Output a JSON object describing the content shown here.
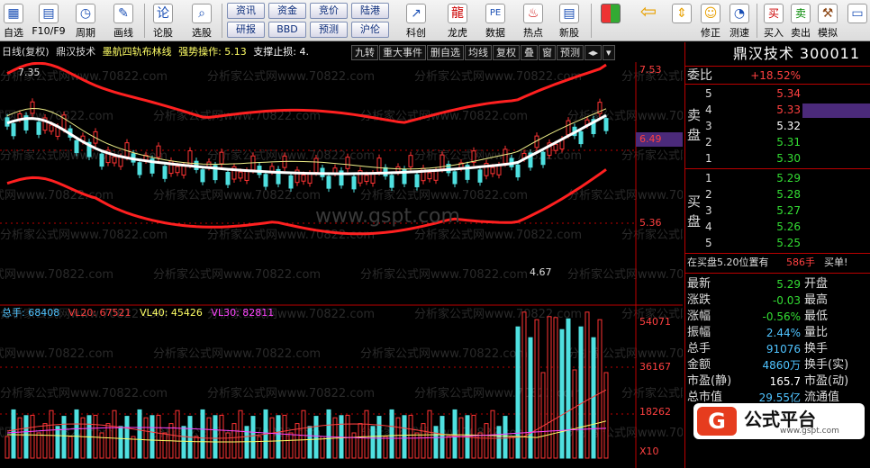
{
  "toolbar": {
    "buttons": [
      {
        "label": "自选",
        "icon": "star-grid-icon"
      },
      {
        "label": "F10/F9",
        "icon": "f10-icon"
      },
      {
        "label": "周期",
        "icon": "clock-icon"
      },
      {
        "label": "画线",
        "icon": "pencil-icon"
      },
      {
        "label": "论股",
        "icon": "forum-icon"
      },
      {
        "label": "选股",
        "icon": "search-icon"
      },
      {
        "label": "科创",
        "icon": "chart-icon"
      },
      {
        "label": "龙虎",
        "icon": "dragon-icon"
      },
      {
        "label": "数据",
        "icon": "pe-icon"
      },
      {
        "label": "热点",
        "icon": "hot-icon"
      },
      {
        "label": "新股",
        "icon": "new-stock-icon"
      },
      {
        "label": "修正",
        "icon": "smile-icon"
      },
      {
        "label": "测速",
        "icon": "speed-icon"
      },
      {
        "label": "买入",
        "icon": "buy-icon"
      },
      {
        "label": "卖出",
        "icon": "sell-icon"
      },
      {
        "label": "模拟",
        "icon": "hammer-icon"
      }
    ],
    "small_buttons": [
      "资讯",
      "资金",
      "竞价",
      "陆港",
      "研报",
      "BBD",
      "预测",
      "沪伦"
    ]
  },
  "infobar": {
    "period": "日线(复权)",
    "stock_name": "鼎汉技术",
    "indicator": "墨航四轨布林线",
    "trend_label": "强势操作: 5.13",
    "stop_label": "支撑止损: 4."
  },
  "indicator_tabs": [
    "九转",
    "重大事件",
    "删自选",
    "均线",
    "复权",
    "叠",
    "窗",
    "预测"
  ],
  "price_axis": {
    "top": "7.53",
    "mid": "6.49",
    "low": "5.36"
  },
  "price_marks": {
    "high": "7.35",
    "low": "4.67"
  },
  "volume_legend": {
    "total_label": "总手: 68408",
    "vl20": "VL20: 67521",
    "vl40": "VL40: 45426",
    "vl30": "VL30: 82811"
  },
  "volume_axis": {
    "top": "54071",
    "mid": "36167",
    "low": "18262",
    "unit": "X10"
  },
  "watermark": "分析家公式网www.70822.com",
  "center_watermark": "www.gspt.com",
  "panel": {
    "title": "鼎汉技术 300011",
    "weibi_label": "委比",
    "weibi_value": "+18.52%",
    "sell_label": "卖盘",
    "buy_label": "买盘",
    "sells": [
      {
        "level": "5",
        "price": "5.34"
      },
      {
        "level": "4",
        "price": "5.33"
      },
      {
        "level": "3",
        "price": "5.32"
      },
      {
        "level": "2",
        "price": "5.31"
      },
      {
        "level": "1",
        "price": "5.30"
      }
    ],
    "buys": [
      {
        "level": "1",
        "price": "5.29"
      },
      {
        "level": "2",
        "price": "5.28"
      },
      {
        "level": "3",
        "price": "5.27"
      },
      {
        "level": "4",
        "price": "5.26"
      },
      {
        "level": "5",
        "price": "5.25"
      }
    ],
    "notice": "在买盘5.20位置有",
    "notice_qty": "586手",
    "notice_tail": "买单!",
    "stats": [
      {
        "k": "最新",
        "v": "5.29",
        "k2": "开盘",
        "color": "#33dd33"
      },
      {
        "k": "涨跌",
        "v": "-0.03",
        "k2": "最高",
        "color": "#33dd33"
      },
      {
        "k": "涨幅",
        "v": "-0.56%",
        "k2": "最低",
        "color": "#33dd33"
      },
      {
        "k": "振幅",
        "v": "2.44%",
        "k2": "量比",
        "color": "#4fc3ff"
      },
      {
        "k": "总手",
        "v": "91076",
        "k2": "换手",
        "color": "#4fc3ff"
      },
      {
        "k": "金额",
        "v": "4860万",
        "k2": "换手(实)",
        "color": "#4fc3ff"
      },
      {
        "k": "市盈(静)",
        "v": "165.7",
        "k2": "市盈(动)",
        "color": "#ffffff"
      },
      {
        "k": "总市值",
        "v": "29.55亿",
        "k2": "流通值",
        "color": "#4fc3ff"
      }
    ]
  },
  "brand": {
    "name": "公式平台",
    "url": "www.gspt.com",
    "logo": "G"
  },
  "colors": {
    "up": "#ff3333",
    "down": "#33dd33",
    "band": "#ff2020",
    "mid": "#ffffff",
    "cyan": "#4fc3ff"
  }
}
